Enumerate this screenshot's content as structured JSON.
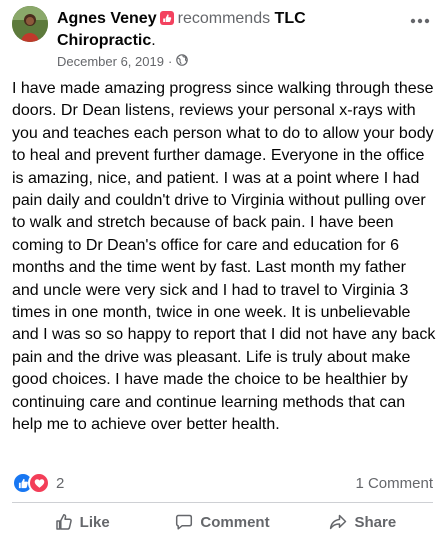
{
  "post": {
    "author_name": "Agnes Veney",
    "recommends_label": "recommends",
    "page_name_line1": "TLC",
    "page_name_line2": "Chiropractic",
    "page_name_suffix": ".",
    "date": "December 6, 2019",
    "meta_separator": "·",
    "audience_icon": "globe-icon",
    "more_icon": "more-options-icon",
    "review_text": "I have made amazing progress since walking through these doors. Dr Dean listens, reviews your personal x-rays with you and teaches each person what to do to allow your body to heal and prevent further damage. Everyone in the office is amazing, nice, and patient. I was at a point where I had pain daily and couldn't drive to Virginia without pulling over to walk and stretch because of back pain. I have been coming to Dr Dean's office for care and education for 6 months and the time went by fast. Last month my father and uncle were very sick and I had to travel to Virginia 3 times in one month, twice in one week. It is unbelievable and I was so so happy to report that I did not have any back pain and the drive was pleasant. Life is truly about  make good choices. I have made the choice to be healthier by continuing care and continue learning methods that can help me to achieve over better health."
  },
  "reactions": {
    "icons": [
      "like-reaction-icon",
      "love-reaction-icon"
    ],
    "count": "2",
    "comments_label": "1 Comment"
  },
  "actions": {
    "like_label": "Like",
    "comment_label": "Comment",
    "share_label": "Share"
  },
  "colors": {
    "text_primary": "#050505",
    "text_secondary": "#65676b",
    "like_blue": "#1877f2",
    "love_red": "#f33e58",
    "recommend_red": "#f3425f",
    "divider": "#ced0d4"
  }
}
